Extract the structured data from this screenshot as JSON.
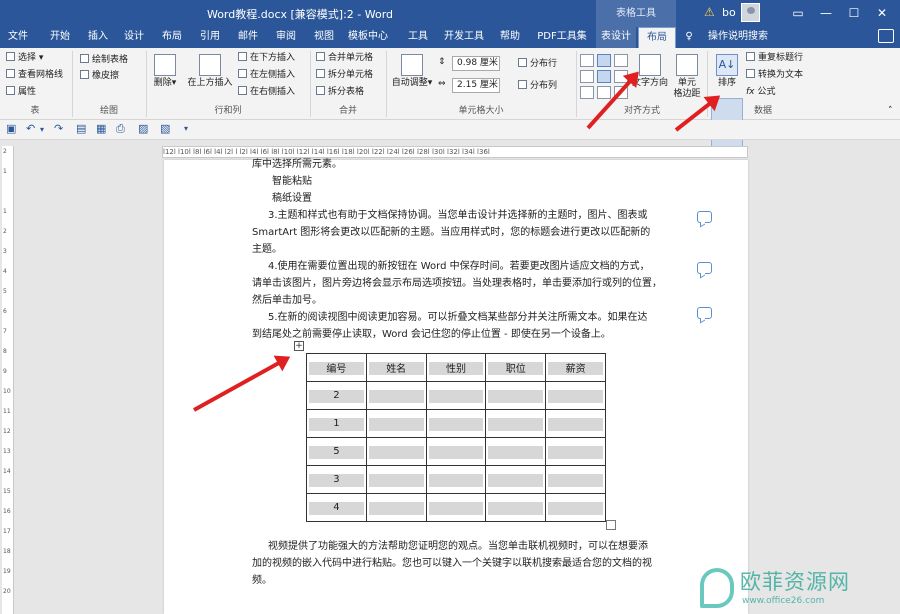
{
  "window": {
    "title": "Word教程.docx [兼容模式]:2  -  Word",
    "context_group": "表格工具",
    "user": "bo"
  },
  "tabs": [
    "文件",
    "开始",
    "插入",
    "设计",
    "布局",
    "引用",
    "邮件",
    "审阅",
    "视图",
    "模板中心",
    "工具",
    "开发工具",
    "帮助",
    "PDF工具集",
    "表设计",
    "布局",
    "操作说明搜索"
  ],
  "ribbon": {
    "groups": {
      "table": "表",
      "draw": "绘图",
      "rows_cols": "行和列",
      "merge": "合并",
      "cell_size": "单元格大小",
      "align": "对齐方式",
      "data": "数据"
    },
    "table": {
      "select": "选择",
      "gridlines": "查看网格线",
      "props": "属性"
    },
    "draw": {
      "draw_table": "绘制表格",
      "eraser": "橡皮擦"
    },
    "rows_cols": {
      "delete": "删除",
      "insert_above": "在上方插入",
      "insert_below": "在下方插入",
      "insert_left": "在左侧插入",
      "insert_right": "在右侧插入"
    },
    "merge": {
      "merge_cells": "合并单元格",
      "split_cells": "拆分单元格",
      "split_table": "拆分表格"
    },
    "cell_size": {
      "autofit": "自动调整",
      "height": "0.98 厘米",
      "width": "2.15 厘米",
      "dist_rows": "分布行",
      "dist_cols": "分布列"
    },
    "align": {
      "text_dir": "文字方向",
      "margins": "单元\n格边距"
    },
    "data": {
      "sort": "排序",
      "repeat_header": "重复标题行",
      "to_text": "转换为文本",
      "formula": "公式"
    }
  },
  "ruler": {
    "h": "l12l  l10l  l8l  l6l  l4l  l2l   l   l2l  l4l  l6l  l8l  l10l  l12l  l14l  l16l  l18l  l20l  l22l  l24l  l26l  l28l  l30l  l32l  l34l  l36l",
    "v": [
      "2",
      "1",
      "",
      "1",
      "2",
      "3",
      "4",
      "5",
      "6",
      "7",
      "8",
      "9",
      "10",
      "11",
      "12",
      "13",
      "14",
      "15",
      "16",
      "17",
      "18",
      "19",
      "20"
    ]
  },
  "document": {
    "lines": [
      "库中选择所需元素。",
      "智能粘贴",
      "稿纸设置",
      "3.主题和样式也有助于文档保持协调。当您单击设计并选择新的主题时，图片、图表或",
      "SmartArt 图形将会更改以匹配新的主题。当应用样式时，您的标题会进行更改以匹配新的",
      "主题。",
      "4.使用在需要位置出现的新按钮在 Word 中保存时间。若要更改图片适应文档的方式，",
      "请单击该图片，图片旁边将会显示布局选项按钮。当处理表格时，单击要添加行或列的位置，",
      "然后单击加号。",
      "5.在新的阅读视图中阅读更加容易。可以折叠文档某些部分并关注所需文本。如果在达",
      "到结尾处之前需要停止读取，Word 会记住您的停止位置 - 即使在另一个设备上。"
    ],
    "table": {
      "headers": [
        "编号",
        "姓名",
        "性别",
        "职位",
        "薪资"
      ],
      "ids": [
        "2",
        "1",
        "5",
        "3",
        "4"
      ]
    },
    "after": [
      "视频提供了功能强大的方法帮助您证明您的观点。当您单击联机视频时，可以在想要添",
      "加的视频的嵌入代码中进行粘贴。您也可以键入一个关键字以联机搜索最适合您的文档的视",
      "频。"
    ]
  },
  "watermark": {
    "name": "欧菲资源网",
    "url": "www.office26.com"
  },
  "colors": {
    "accent": "#2b579a",
    "arrow": "#e02020",
    "shade": "#d7d7d7"
  }
}
